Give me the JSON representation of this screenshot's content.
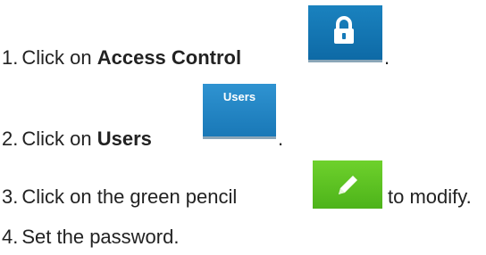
{
  "steps": [
    {
      "num": "1.",
      "pre": "Click on ",
      "bold": "Access Control",
      "post": "."
    },
    {
      "num": "2.",
      "pre": "Click on ",
      "bold": "Users",
      "post": "."
    },
    {
      "num": "3.",
      "pre": "Click on the green pencil",
      "post": "to modify."
    },
    {
      "num": "4.",
      "pre": "Set the password."
    }
  ],
  "tiles": {
    "access_control": {
      "icon": "lock-icon",
      "color": "#1479b8"
    },
    "users": {
      "label": "Users",
      "color": "#2384c4"
    },
    "edit": {
      "icon": "pencil-icon",
      "color": "#5cc523"
    }
  }
}
